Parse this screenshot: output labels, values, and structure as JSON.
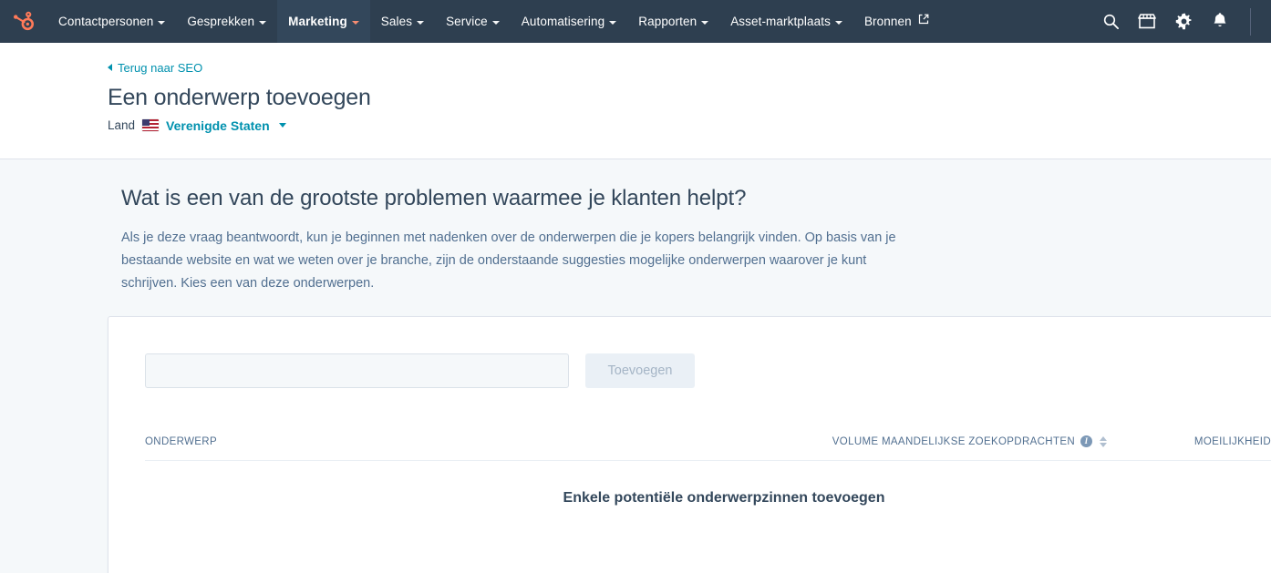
{
  "nav": {
    "logo_icon": "hubspot-sprocket-icon",
    "items": [
      {
        "label": "Contactpersonen",
        "has_chevron": true,
        "active": false
      },
      {
        "label": "Gesprekken",
        "has_chevron": true,
        "active": false
      },
      {
        "label": "Marketing",
        "has_chevron": true,
        "active": true
      },
      {
        "label": "Sales",
        "has_chevron": true,
        "active": false
      },
      {
        "label": "Service",
        "has_chevron": true,
        "active": false
      },
      {
        "label": "Automatisering",
        "has_chevron": true,
        "active": false
      },
      {
        "label": "Rapporten",
        "has_chevron": true,
        "active": false
      },
      {
        "label": "Asset-marktplaats",
        "has_chevron": true,
        "active": false
      },
      {
        "label": "Bronnen",
        "has_chevron": false,
        "external": true,
        "active": false
      }
    ],
    "right_icons": [
      {
        "name": "search-icon"
      },
      {
        "name": "marketplace-icon"
      },
      {
        "name": "gear-icon"
      },
      {
        "name": "notifications-bell-icon"
      }
    ],
    "bg_color": "#2e3f50",
    "active_bg_color": "#33475b",
    "brand_color": "#ff7a59"
  },
  "header": {
    "back_link": "Terug naar SEO",
    "title": "Een onderwerp toevoegen",
    "country_label": "Land",
    "country_value": "Verenigde Staten",
    "country_flag_icon": "flag-us-icon",
    "link_color": "#0091ae"
  },
  "intro": {
    "heading": "Wat is een van de grootste problemen waarmee je klanten helpt?",
    "paragraph": "Als je deze vraag beantwoordt, kun je beginnen met nadenken over de onderwerpen die je kopers belangrijk vinden. Op basis van je bestaande website en wat we weten over je branche, zijn de onderstaande suggesties mogelijke onderwerpen waarover je kunt schrijven. Kies een van deze onderwerpen."
  },
  "card": {
    "input_value": "",
    "input_placeholder": "",
    "add_button_label": "Toevoegen",
    "add_button_disabled": true,
    "table": {
      "columns": [
        {
          "label": "ONDERWERP",
          "has_info": false,
          "has_sort": false,
          "align": "left"
        },
        {
          "label": "VOLUME MAANDELIJKSE ZOEKOPDRACHTEN",
          "has_info": true,
          "has_sort": true,
          "align": "right"
        },
        {
          "label": "MOEILIJKHEID",
          "has_info": true,
          "has_sort": true,
          "align": "right"
        }
      ],
      "rows": [],
      "empty_message": "Enkele potentiële onderwerpzinnen toevoegen"
    }
  },
  "colors": {
    "page_bg": "#f5f8fa",
    "card_bg": "#ffffff",
    "text_primary": "#33475b",
    "text_secondary": "#516f90",
    "border": "#dfe3eb"
  }
}
